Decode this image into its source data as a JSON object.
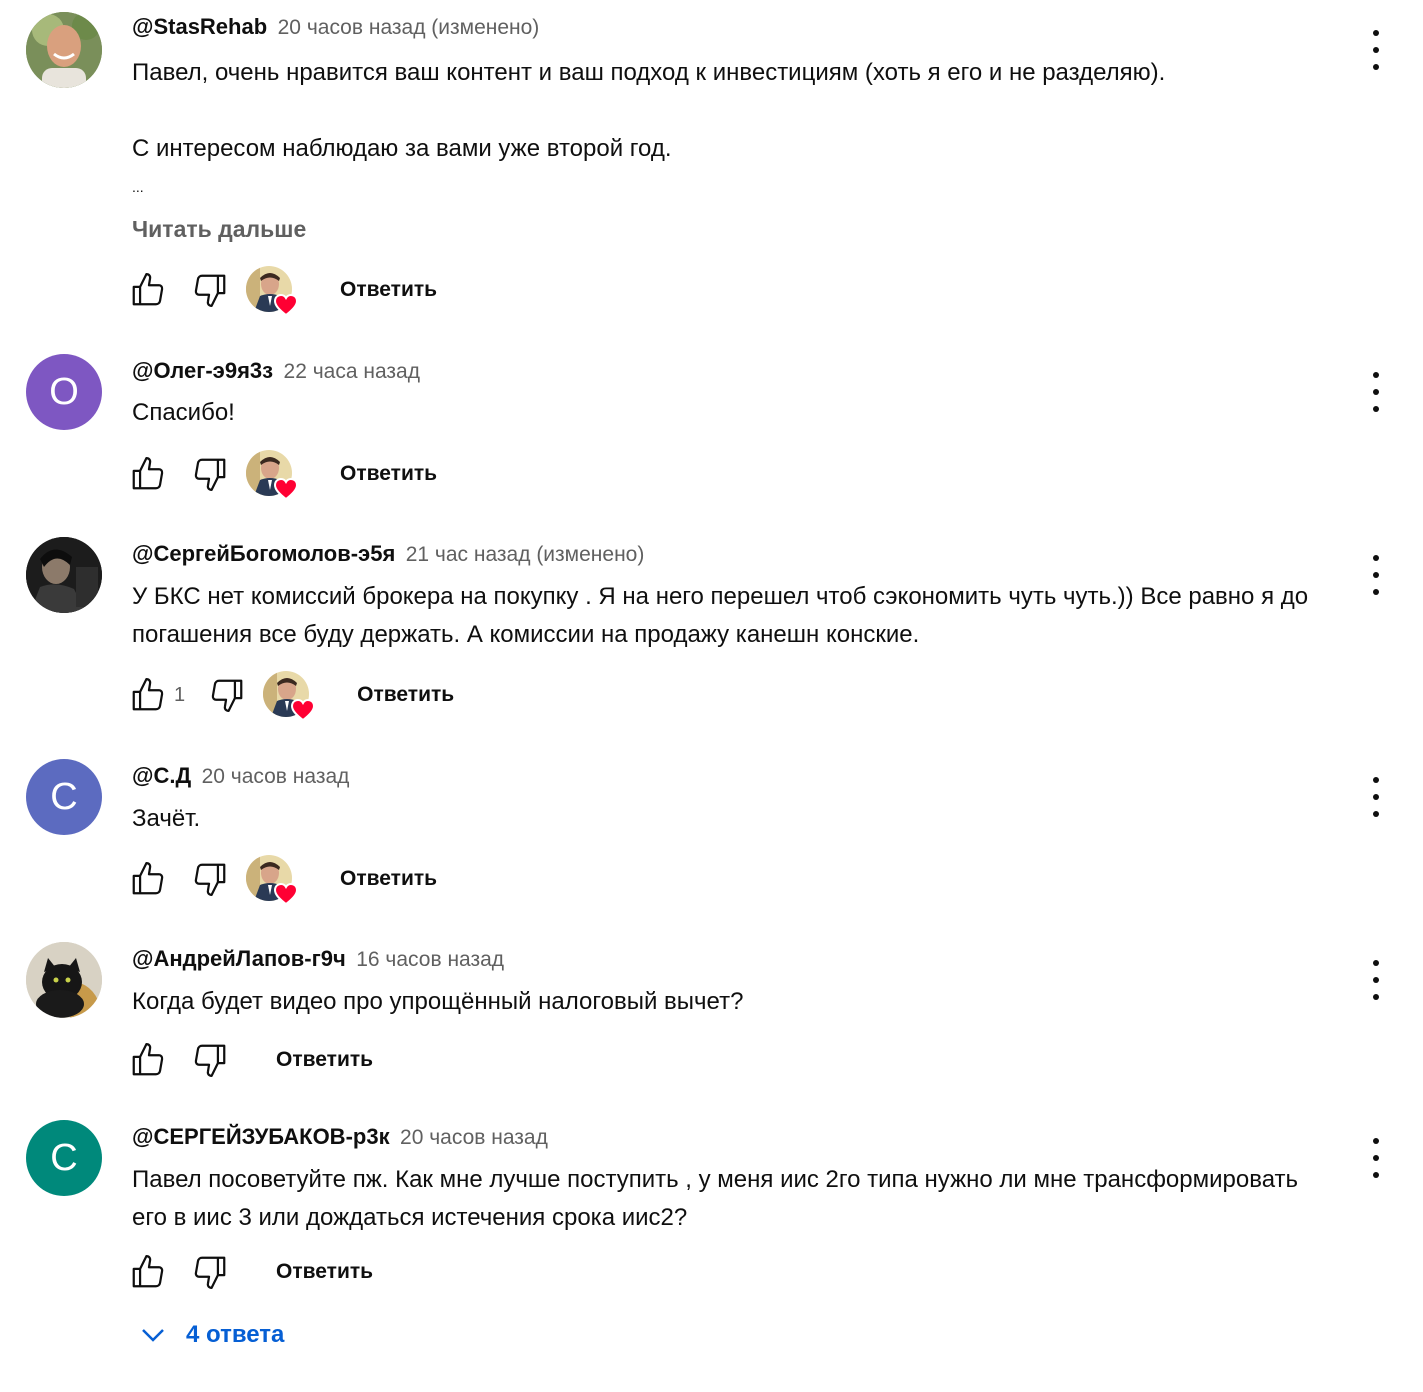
{
  "comments": [
    {
      "author": "@StasRehab",
      "time": "20 часов назад (изменено)",
      "text": "Павел, очень нравится ваш контент и ваш подход к инвестициям (хоть я его и не разделяю).\n\nС интересом наблюдаю за вами уже второй год.",
      "ellipsis": "...",
      "read_more": "Читать дальше",
      "likes": "",
      "hearted": true,
      "reply": "Ответить"
    },
    {
      "author": "@Олег-э9я3з",
      "time": "22 часа назад",
      "text": "Спасибо!",
      "avatar_letter": "О",
      "avatar_color": "#7e57c2",
      "likes": "",
      "hearted": true,
      "reply": "Ответить"
    },
    {
      "author": "@СергейБогомолов-э5я",
      "time": "21 час назад (изменено)",
      "text": "У БКС нет комиссий брокера на покупку . Я на него перешел чтоб сэкономить чуть чуть.)) Все равно я до погашения все буду держать. А комиссии на продажу канешн конские.",
      "likes": "1",
      "hearted": true,
      "reply": "Ответить"
    },
    {
      "author": "@С.Д",
      "time": "20 часов назад",
      "text": "Зачёт.",
      "avatar_letter": "С",
      "avatar_color": "#5c6bc0",
      "likes": "",
      "hearted": true,
      "reply": "Ответить"
    },
    {
      "author": "@АндрейЛапов-г9ч",
      "time": "16 часов назад",
      "text": "Когда будет видео про упрощённый налоговый вычет?",
      "likes": "",
      "hearted": false,
      "reply": "Ответить"
    },
    {
      "author": "@СЕРГЕЙЗУБАКОВ-р3к",
      "time": "20 часов назад",
      "text": "Павел посоветуйте пж. Как мне лучше поступить , у меня иис 2го типа нужно ли мне трансформировать его в иис 3 или дождаться истечения срока иис2?",
      "avatar_letter": "С",
      "avatar_color": "#00897b",
      "likes": "",
      "hearted": false,
      "reply": "Ответить",
      "replies_label": "4 ответа"
    }
  ]
}
